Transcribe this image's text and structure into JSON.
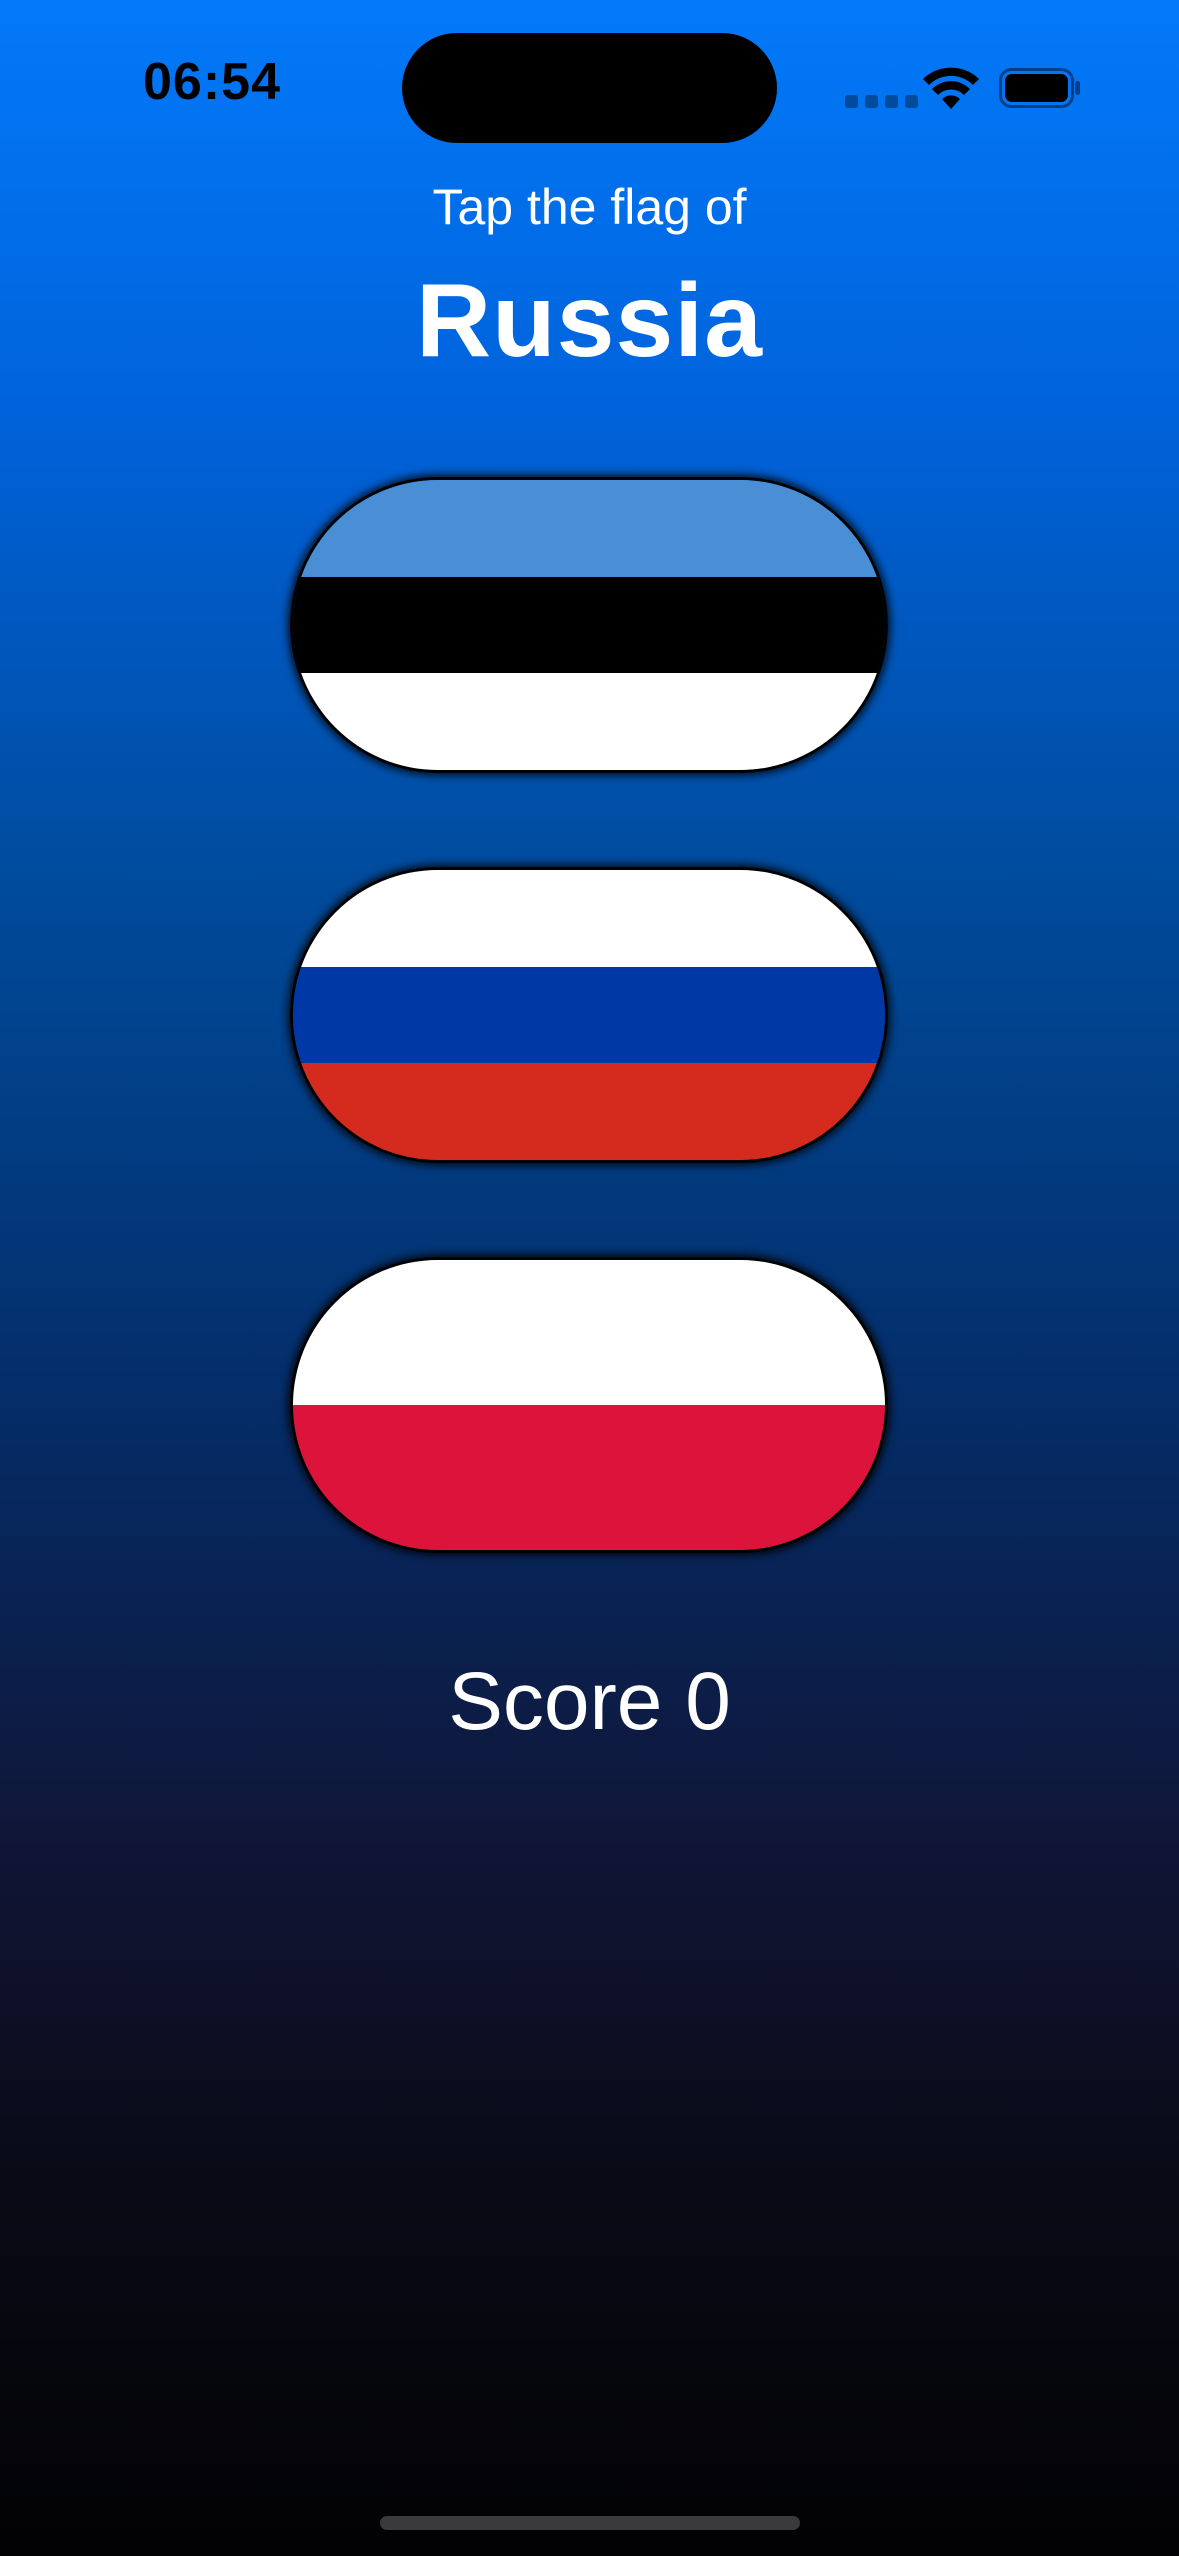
{
  "status_bar": {
    "time": "06:54",
    "icons": [
      "cellular-signal-icon",
      "wifi-icon",
      "battery-icon"
    ]
  },
  "prompt": {
    "label": "Tap the flag of",
    "country": "Russia"
  },
  "flags": [
    {
      "icon": "estonia-flag",
      "stripes": [
        "#4a8fd6",
        "#000000",
        "#ffffff"
      ]
    },
    {
      "icon": "russia-flag",
      "stripes": [
        "#ffffff",
        "#0039a6",
        "#d52b1e"
      ]
    },
    {
      "icon": "poland-flag",
      "stripes": [
        "#ffffff",
        "#dc143c"
      ]
    }
  ],
  "score": {
    "label": "Score",
    "value": "0"
  },
  "colors": {
    "gradient_top": "#0379f9",
    "gradient_bottom": "#020204",
    "text": "#ffffff"
  }
}
